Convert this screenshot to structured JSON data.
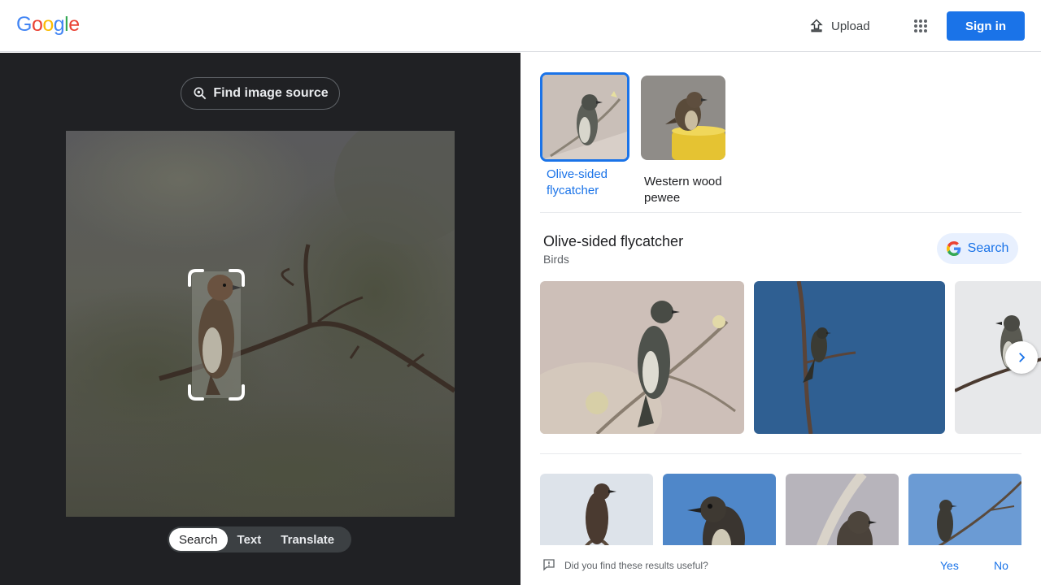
{
  "header": {
    "logo_letters": [
      "G",
      "o",
      "o",
      "g",
      "l",
      "e"
    ],
    "logo_colors": [
      "#4285f4",
      "#ea4335",
      "#fbbc05",
      "#4285f4",
      "#34a853",
      "#ea4335"
    ],
    "upload_label": "Upload",
    "signin_label": "Sign in"
  },
  "left": {
    "find_source_label": "Find image source",
    "tabs": [
      {
        "label": "Search",
        "active": true
      },
      {
        "label": "Text",
        "active": false
      },
      {
        "label": "Translate",
        "active": false
      }
    ]
  },
  "right": {
    "suggestions": [
      {
        "label": "Olive-sided flycatcher",
        "selected": true
      },
      {
        "label": "Western wood pewee",
        "selected": false
      }
    ],
    "entity": {
      "title": "Olive-sided flycatcher",
      "subtitle": "Birds",
      "search_label": "Search"
    },
    "feedback": {
      "question": "Did you find these results useful?",
      "yes": "Yes",
      "no": "No"
    }
  },
  "colors": {
    "accent": "#1a73e8",
    "dark_panel": "#202124"
  }
}
